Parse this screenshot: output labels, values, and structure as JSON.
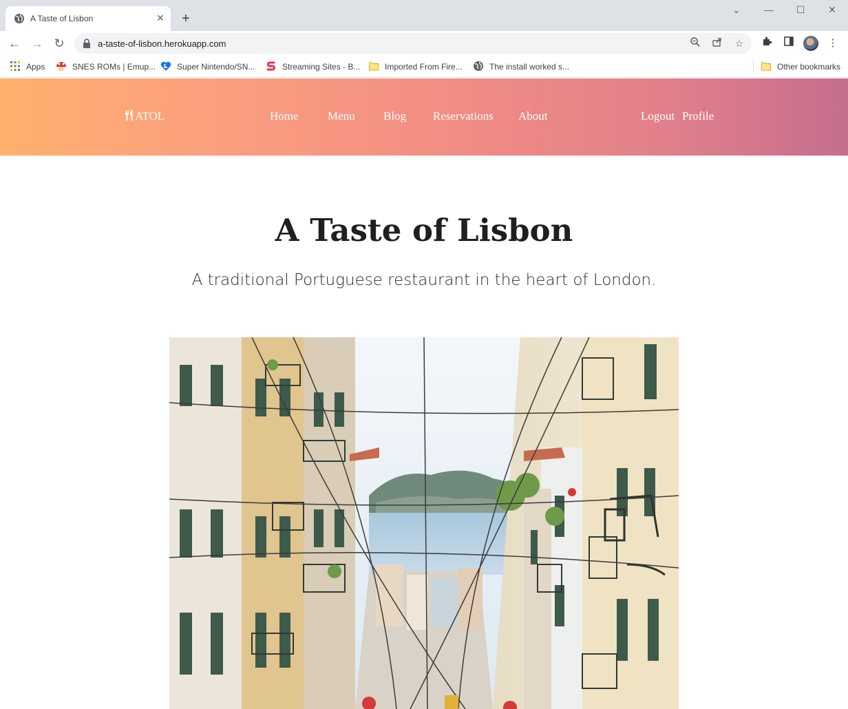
{
  "browser": {
    "tab_title": "A Taste of Lisbon",
    "url": "a-taste-of-lisbon.herokuapp.com",
    "bookmarks": [
      {
        "label": "Apps",
        "icon": "apps-grid-icon"
      },
      {
        "label": "SNES ROMs | Emup...",
        "icon": "mushroom-icon"
      },
      {
        "label": "Super Nintendo/SN...",
        "icon": "heart-l-icon"
      },
      {
        "label": "Streaming Sites - B...",
        "icon": "s-logo-icon"
      },
      {
        "label": "Imported From Fire...",
        "icon": "folder-icon"
      },
      {
        "label": "The install worked s...",
        "icon": "globe-icon"
      }
    ],
    "other_bookmarks": "Other bookmarks"
  },
  "site": {
    "brand": "ATOL",
    "nav": [
      "Home",
      "Menu",
      "Blog",
      "Reservations",
      "About"
    ],
    "auth": [
      "Logout",
      "Profile"
    ],
    "header_gradient": [
      "#ffb06d",
      "#fb9f7e",
      "#f18c84",
      "#df7f8b",
      "#c56e8c"
    ]
  },
  "hero": {
    "title": "A Taste of Lisbon",
    "subtitle": "A traditional Portuguese restaurant in the heart of London."
  }
}
